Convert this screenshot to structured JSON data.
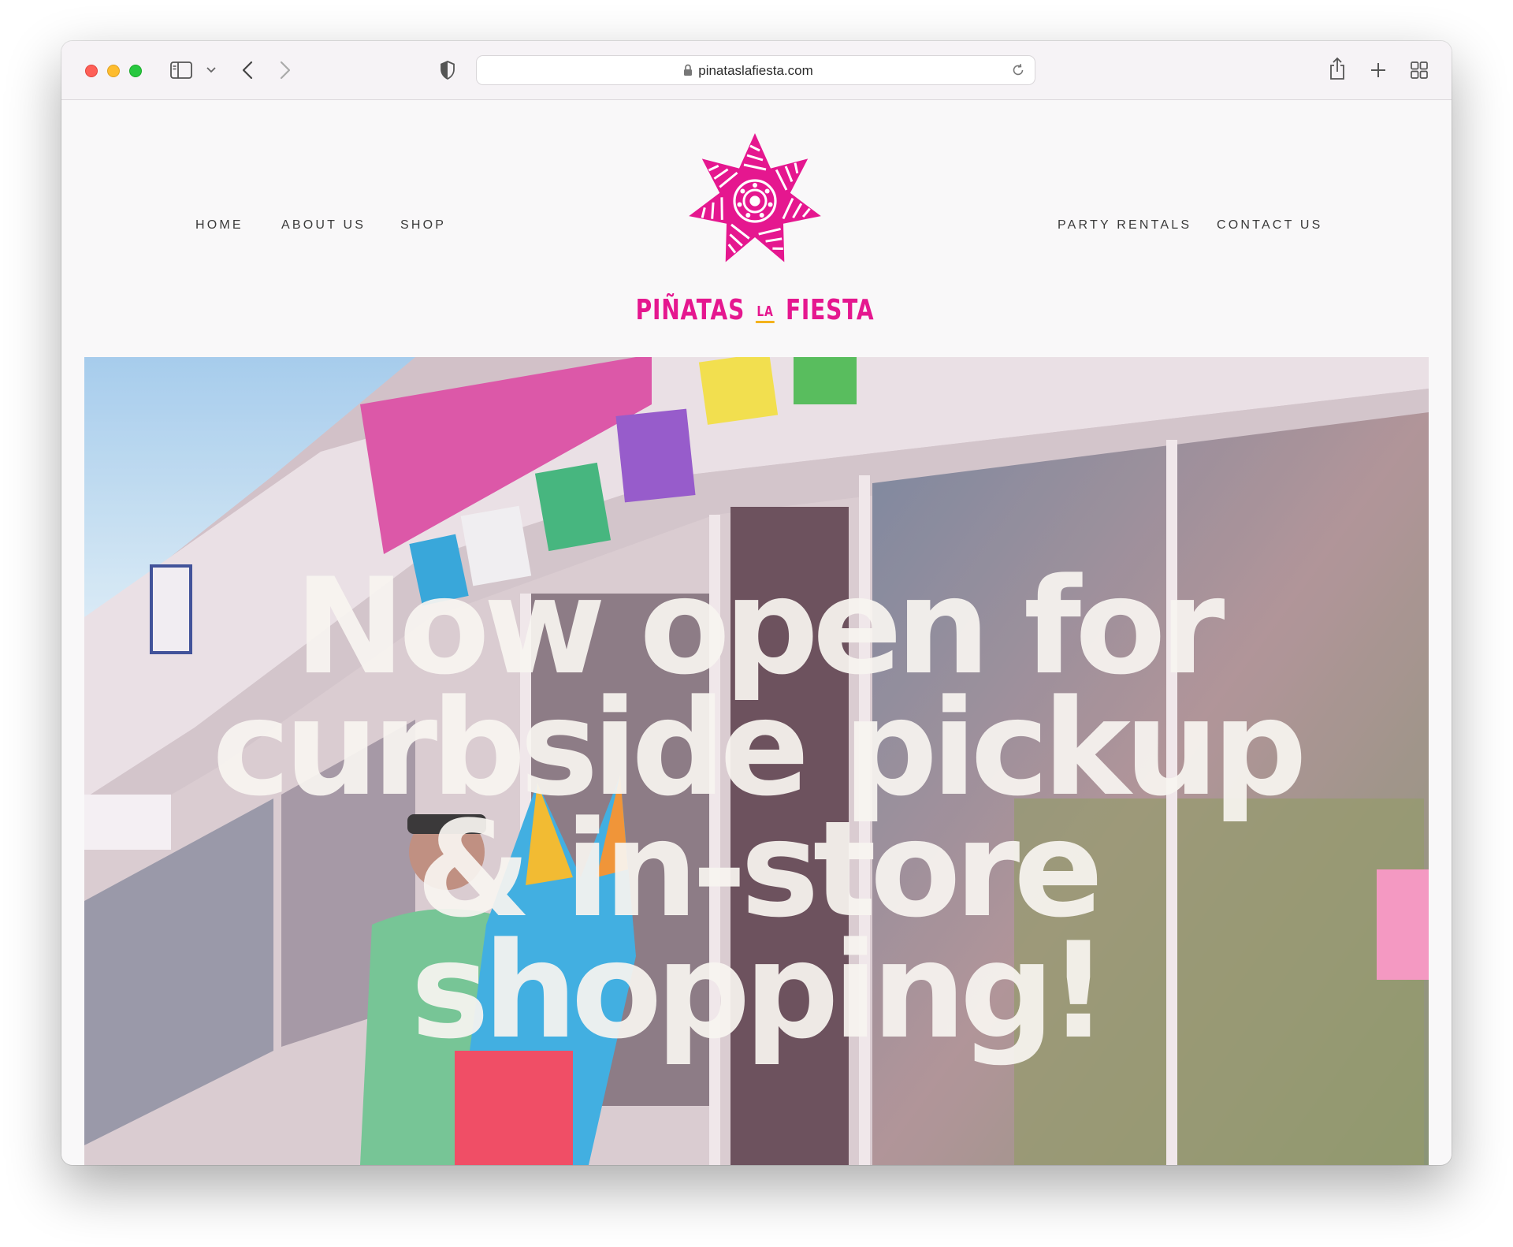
{
  "browser": {
    "url": "pinataslafiesta.com",
    "icons": [
      "sidebar-icon",
      "chevron-down-icon",
      "back-icon",
      "forward-icon",
      "shield-icon",
      "lock-icon",
      "reload-icon",
      "share-icon",
      "new-tab-icon",
      "tab-overview-icon"
    ]
  },
  "nav": {
    "left": [
      "HOME",
      "ABOUT US",
      "SHOP"
    ],
    "right": [
      "PARTY RENTALS",
      "CONTACT US"
    ]
  },
  "logo": {
    "word1": "PIÑATAS",
    "word2": "LA",
    "word3": "FIESTA",
    "color": "#e5178f",
    "accent": "#f3b21c"
  },
  "hero": {
    "lines": [
      "Now open for",
      "curbside pickup",
      "& in-store",
      "shopping!"
    ],
    "text_color": "#f8f4f0"
  }
}
